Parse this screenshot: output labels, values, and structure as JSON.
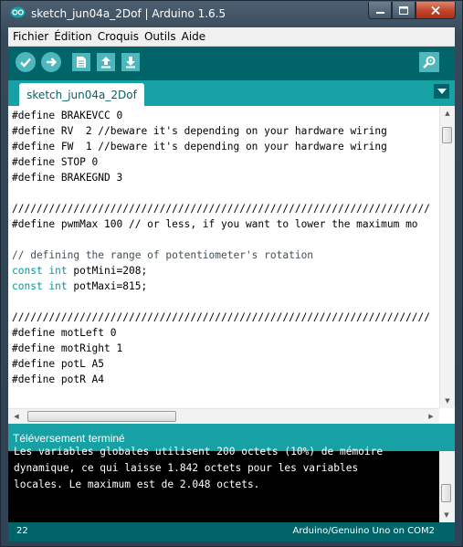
{
  "window": {
    "title": "sketch_jun04a_2Dof | Arduino 1.6.5"
  },
  "menu": [
    "Fichier",
    "Édition",
    "Croquis",
    "Outils",
    "Aide"
  ],
  "toolbar": {
    "buttons": [
      "verify-icon",
      "upload-icon",
      "new-icon",
      "open-icon",
      "save-icon"
    ],
    "serial_monitor": "serial-monitor-icon"
  },
  "tabs": [
    {
      "label": "sketch_jun04a_2Dof"
    }
  ],
  "editor": {
    "lines": [
      "#define BRAKEVCC 0",
      "#define RV  2 //beware it's depending on your hardware wiring",
      "#define FW  1 //beware it's depending on your hardware wiring",
      "#define STOP 0",
      "#define BRAKEGND 3",
      "",
      "////////////////////////////////////////////////////////////////////",
      "#define pwmMax 100 // or less, if you want to lower the maximum mo",
      "",
      "// defining the range of potentiometer's rotation",
      "const int potMini=208;",
      "const int potMaxi=815;",
      "",
      "////////////////////////////////////////////////////////////////////",
      "#define motLeft 0",
      "#define motRight 1",
      "#define potL A5",
      "#define potR A4",
      ""
    ],
    "keyword_color": "#00979c"
  },
  "status": {
    "message": "Téléversement terminé"
  },
  "console": {
    "lines": [
      "Les variables globales utilisent 200 octets (10%) de mémoire",
      "dynamique, ce qui laisse 1.842 octets pour les variables",
      "locales. Le maximum est de 2.048 octets."
    ]
  },
  "footer": {
    "line_number": "22",
    "board": "Arduino/Genuino Uno on COM2"
  },
  "colors": {
    "teal_dark": "#006468",
    "teal_light": "#17a1a5",
    "button": "#4db7bb"
  }
}
